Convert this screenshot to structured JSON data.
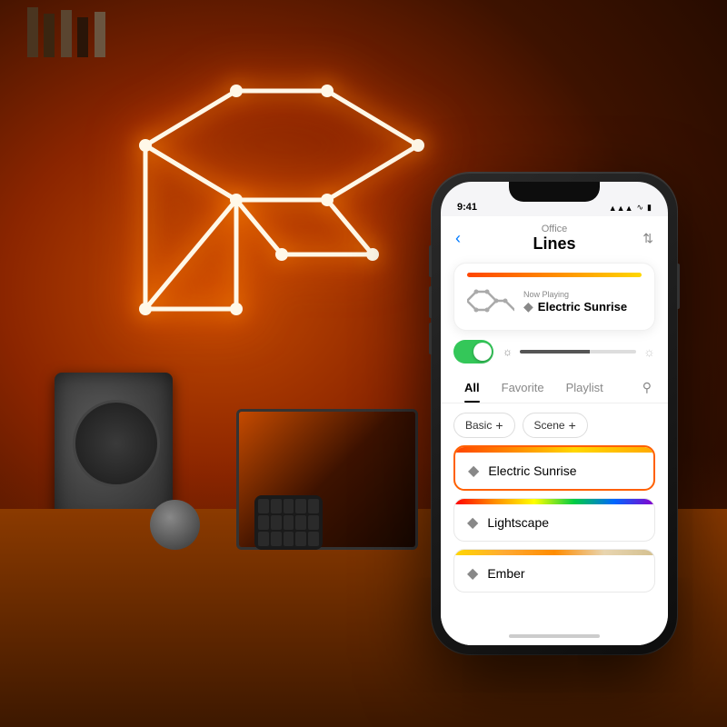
{
  "background": {
    "description": "Warm orange-lit office room with geometric light art on wall"
  },
  "phone": {
    "status_bar": {
      "time": "9:41",
      "signal": "▲▲▲",
      "wifi": "wifi",
      "battery": "battery"
    },
    "header": {
      "back_label": "‹",
      "location": "Office",
      "title": "Lines",
      "settings_icon": "⇅"
    },
    "now_playing": {
      "label": "Now Playing",
      "scene_name": "Electric Sunrise",
      "gradient_type": "electric"
    },
    "controls": {
      "toggle_on": true,
      "brightness_pct": 60
    },
    "tabs": [
      {
        "id": "all",
        "label": "All",
        "active": true
      },
      {
        "id": "favorite",
        "label": "Favorite",
        "active": false
      },
      {
        "id": "playlist",
        "label": "Playlist",
        "active": false
      }
    ],
    "filters": [
      {
        "id": "basic",
        "label": "Basic"
      },
      {
        "id": "scene",
        "label": "Scene"
      }
    ],
    "scenes": [
      {
        "id": "electric-sunrise",
        "name": "Electric Sunrise",
        "gradient": "electric",
        "active": true
      },
      {
        "id": "lightscape",
        "name": "Lightscape",
        "gradient": "lightscape",
        "active": false
      },
      {
        "id": "ember",
        "name": "Ember",
        "gradient": "ember",
        "active": false
      }
    ]
  }
}
